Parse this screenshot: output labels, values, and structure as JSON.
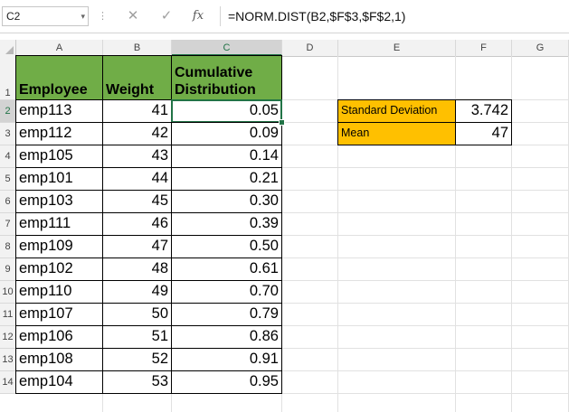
{
  "formula_bar": {
    "name_box": "C2",
    "dropdown_icon": "▾",
    "separator": "⋮",
    "cancel_icon": "✕",
    "enter_icon": "✓",
    "fx_label": "fx",
    "formula": "=NORM.DIST(B2,$F$3,$F$2,1)"
  },
  "columns": [
    "A",
    "B",
    "C",
    "D",
    "E",
    "F",
    "G"
  ],
  "active_column": "C",
  "rows": [
    "1",
    "2",
    "3",
    "4",
    "5",
    "6",
    "7",
    "8",
    "9",
    "10",
    "11",
    "12",
    "13",
    "14"
  ],
  "active_row": "2",
  "table": {
    "headers": [
      "Employee",
      "Weight",
      "Cumulative\nDistribution"
    ],
    "header_color": "#70ad47",
    "rows": [
      [
        "emp113",
        "41",
        "0.05"
      ],
      [
        "emp112",
        "42",
        "0.09"
      ],
      [
        "emp105",
        "43",
        "0.14"
      ],
      [
        "emp101",
        "44",
        "0.21"
      ],
      [
        "emp103",
        "45",
        "0.30"
      ],
      [
        "emp111",
        "46",
        "0.39"
      ],
      [
        "emp109",
        "47",
        "0.50"
      ],
      [
        "emp102",
        "48",
        "0.61"
      ],
      [
        "emp110",
        "49",
        "0.70"
      ],
      [
        "emp107",
        "50",
        "0.79"
      ],
      [
        "emp106",
        "51",
        "0.86"
      ],
      [
        "emp108",
        "52",
        "0.91"
      ],
      [
        "emp104",
        "53",
        "0.95"
      ]
    ]
  },
  "params": {
    "color": "#ffc000",
    "rows": [
      {
        "label": "Standard Deviation",
        "value": "3.742"
      },
      {
        "label": "Mean",
        "value": "47"
      }
    ]
  },
  "selected_cell": "C2",
  "accent_color": "#217346"
}
